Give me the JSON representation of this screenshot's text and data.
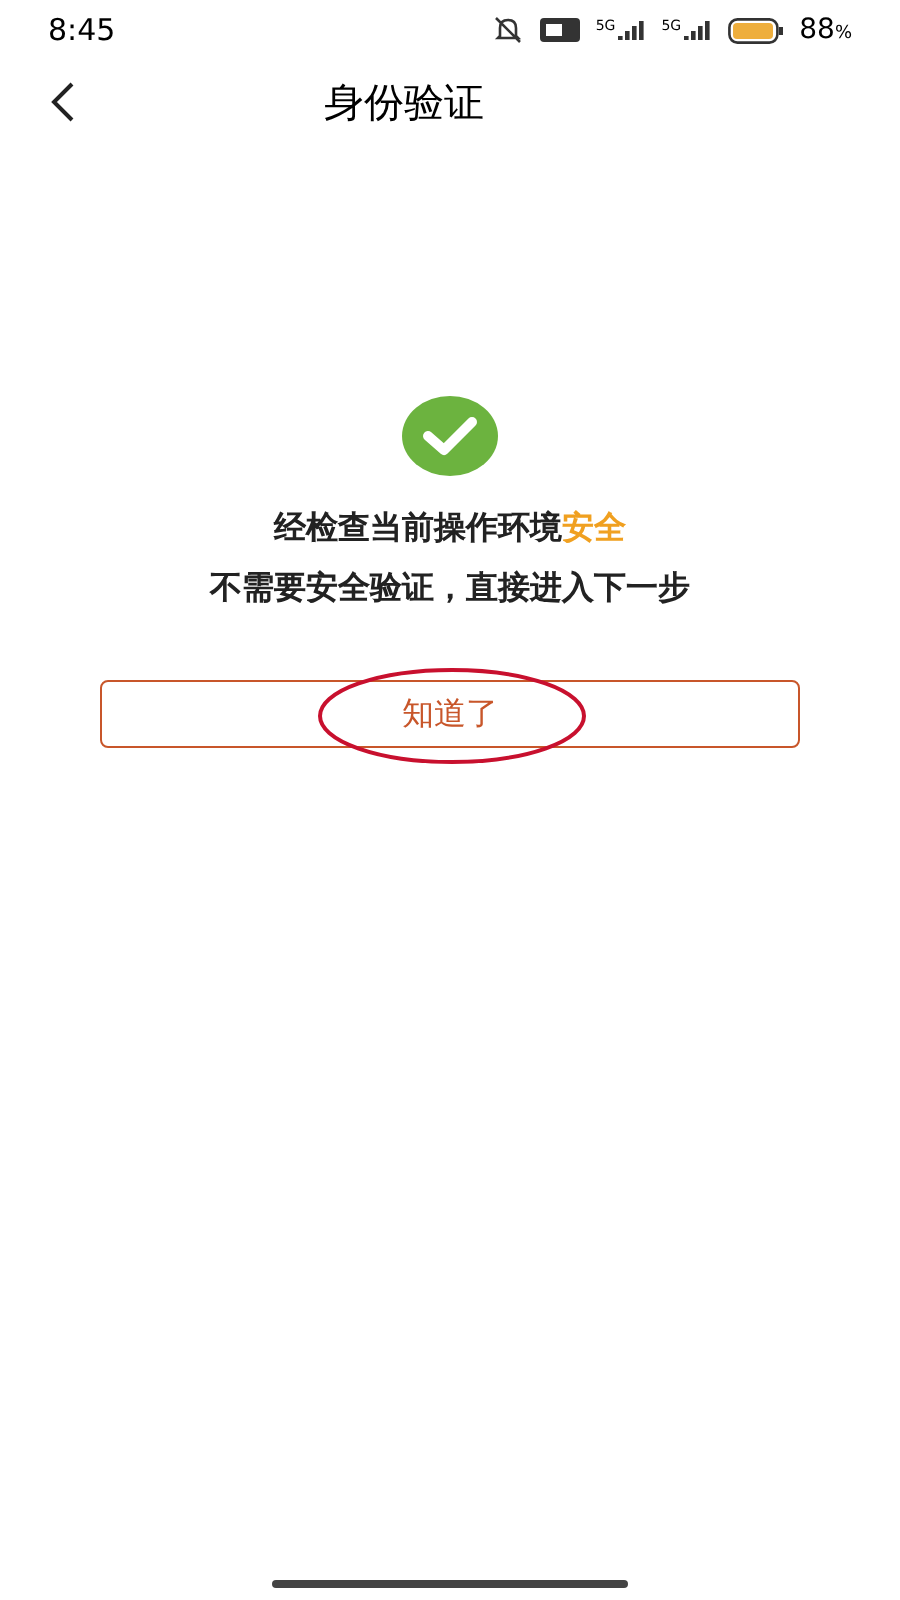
{
  "status_bar": {
    "time": "8:45",
    "network_1": "5G",
    "network_2": "5G",
    "battery": "88",
    "battery_unit": "%"
  },
  "header": {
    "title": "身份验证"
  },
  "result": {
    "line_1": "经检查当前操作环境",
    "line_1_highlight": "安全",
    "line_2": "不需要安全验证，直接进入下一步"
  },
  "button": {
    "label": "知道了"
  }
}
